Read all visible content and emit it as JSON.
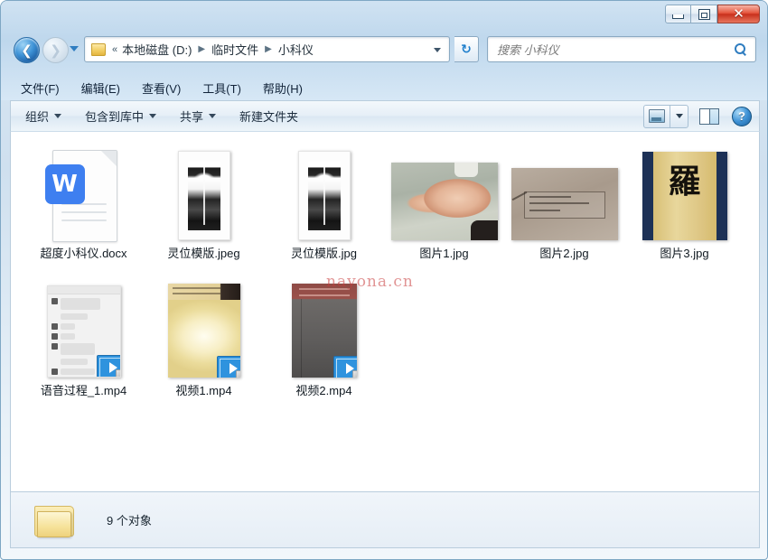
{
  "window": {
    "buttons": {
      "minimize": "–",
      "maximize": "□",
      "close": "✕"
    }
  },
  "address_bar": {
    "back_icon": "◀",
    "forward_icon": "▶",
    "folder_icon": "folder-icon",
    "chevron": "«",
    "crumbs": [
      "本地磁盘 (D:)",
      "临时文件",
      "小科仪"
    ],
    "separator": "▶",
    "refresh_icon": "↻",
    "dropdown_icon": "▼"
  },
  "search": {
    "placeholder": "搜索 小科仪",
    "icon": "search-icon"
  },
  "menu": {
    "items": [
      {
        "label": "文件(F)"
      },
      {
        "label": "编辑(E)"
      },
      {
        "label": "查看(V)"
      },
      {
        "label": "工具(T)"
      },
      {
        "label": "帮助(H)"
      }
    ]
  },
  "toolbar": {
    "organize": "组织",
    "include_library": "包含到库中",
    "share": "共享",
    "new_folder": "新建文件夹",
    "view_icon": "view-mode-icon",
    "preview_pane_icon": "preview-pane-icon",
    "help_icon": "?"
  },
  "files": [
    {
      "name": "超度小科仪.docx",
      "type": "docx"
    },
    {
      "name": "灵位模版.jpeg",
      "type": "image-tall"
    },
    {
      "name": "灵位模版.jpg",
      "type": "image-tall"
    },
    {
      "name": "图片1.jpg",
      "type": "image-hand"
    },
    {
      "name": "图片2.jpg",
      "type": "image-note"
    },
    {
      "name": "图片3.jpg",
      "type": "image-scroll"
    },
    {
      "name": "语音过程_1.mp4",
      "type": "video-chat"
    },
    {
      "name": "视频1.mp4",
      "type": "video-yellow"
    },
    {
      "name": "视频2.mp4",
      "type": "video-dark"
    }
  ],
  "scroll_glyph": "羅",
  "watermark": "nayona.cn",
  "status": {
    "folder_icon": "folder-icon",
    "text": "9 个对象"
  }
}
